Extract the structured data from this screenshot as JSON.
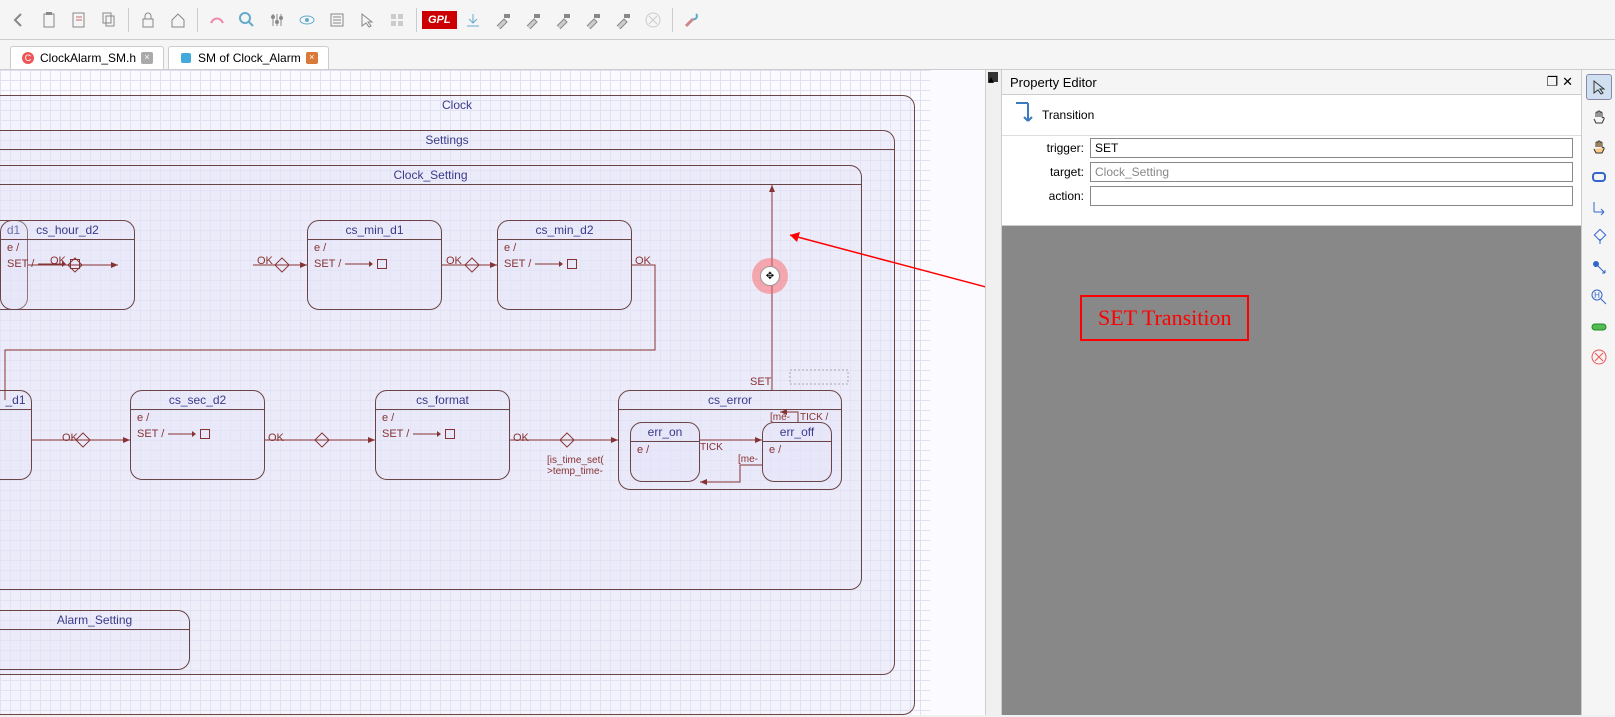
{
  "toolbar": {
    "gpl": "GPL"
  },
  "tabs": [
    {
      "label": "ClockAlarm_SM.h",
      "icon": "c-header"
    },
    {
      "label": "SM of Clock_Alarm",
      "icon": "sm"
    }
  ],
  "property_editor": {
    "title": "Property Editor",
    "type_label": "Transition",
    "fields": {
      "trigger": {
        "label": "trigger:",
        "value": "SET"
      },
      "target": {
        "label": "target:",
        "value": "Clock_Setting"
      },
      "action": {
        "label": "action:",
        "value": ""
      }
    }
  },
  "annotation": {
    "text": "SET Transition"
  },
  "diagram": {
    "clock": "Clock",
    "settings": "Settings",
    "clock_setting": "Clock_Setting",
    "alarm_setting": "Alarm_Setting",
    "d1": "d1",
    "states": {
      "cs_hour_d2": "cs_hour_d2",
      "cs_min_d1": "cs_min_d1",
      "cs_min_d2": "cs_min_d2",
      "cs_sec_d2": "cs_sec_d2",
      "cs_format": "cs_format",
      "cs_error": "cs_error",
      "err_on": "err_on",
      "err_off": "err_off",
      "e_d1": "_d1"
    },
    "entry": "e /",
    "set_trans": "SET /",
    "ok": "OK",
    "set": "SET",
    "tick": "TICK /",
    "tick2": "TICK",
    "me": "[me-",
    "guard": "[is_time_set(\n>temp_time-"
  }
}
